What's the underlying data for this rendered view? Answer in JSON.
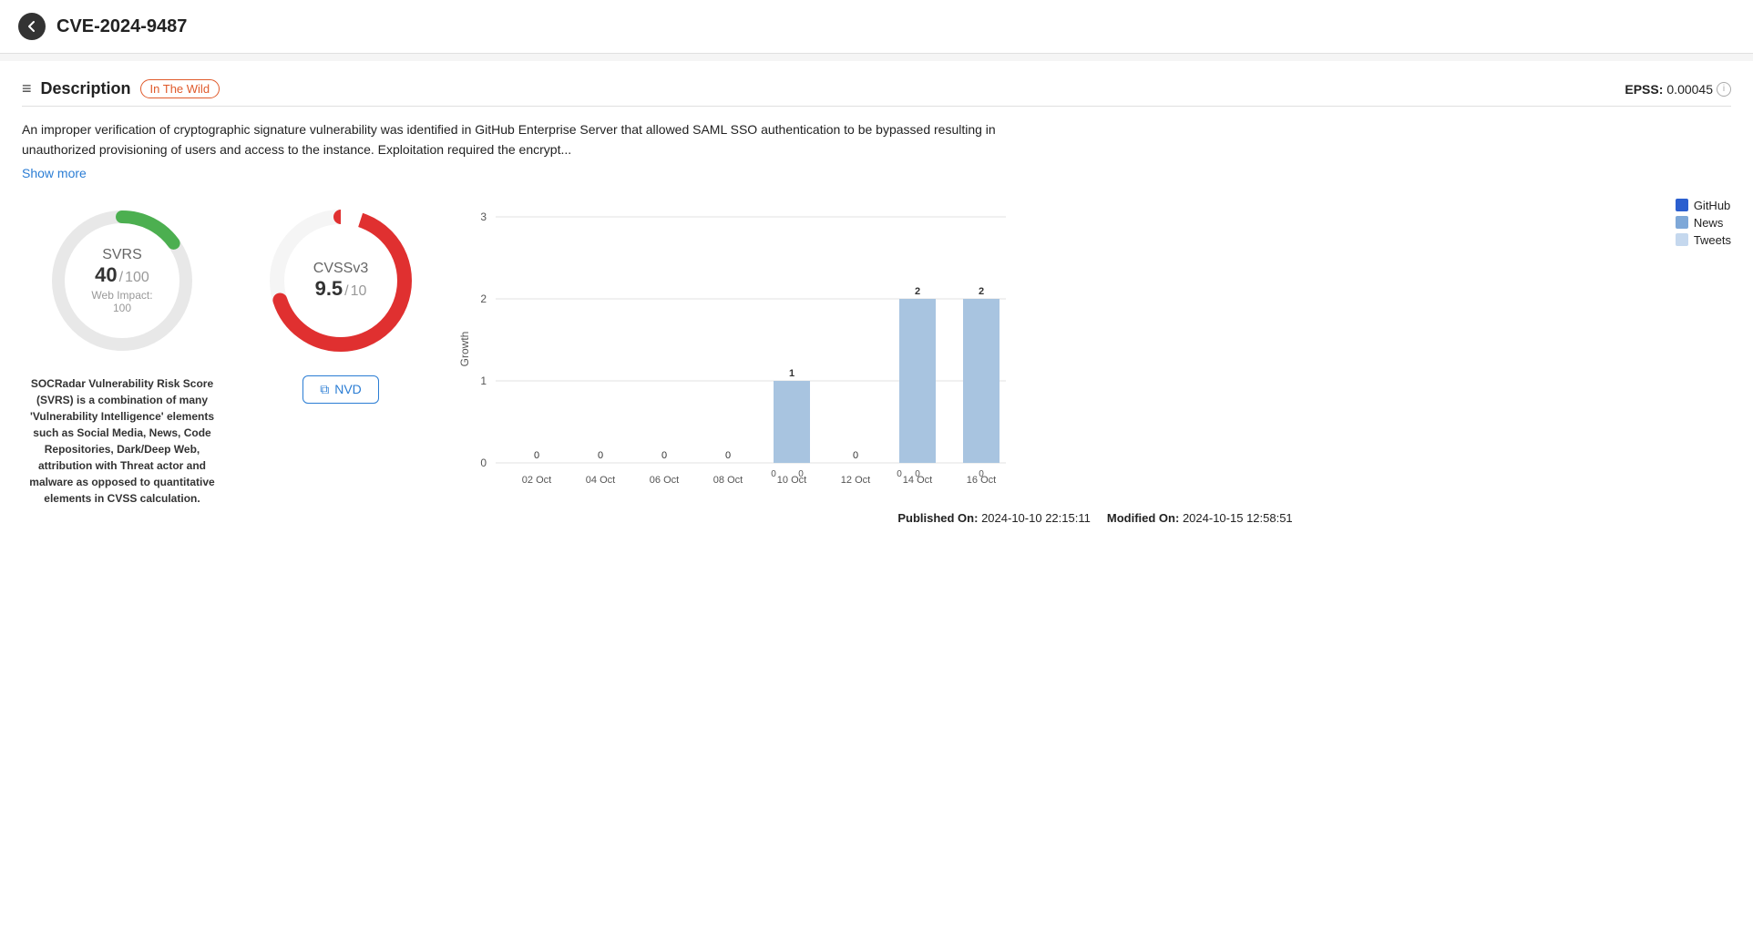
{
  "header": {
    "back_label": "←",
    "title": "CVE-2024-9487"
  },
  "description_section": {
    "icon": "≡",
    "title": "Description",
    "badge": "In The Wild",
    "epss_label": "EPSS:",
    "epss_value": "0.00045",
    "info_icon": "i",
    "text": "An improper verification of cryptographic signature vulnerability was identified in GitHub Enterprise Server that allowed SAML SSO authentication to be bypassed resulting in unauthorized provisioning of users and access to the instance. Exploitation required the encrypt...",
    "show_more": "Show more"
  },
  "svrs": {
    "label": "SVRS",
    "value": "40",
    "separator": "/",
    "max": "100",
    "impact_label": "Web Impact: 100",
    "description": "SOCRadar Vulnerability Risk Score (SVRS) is a combination of many 'Vulnerability Intelligence' elements such as Social Media, News, Code Repositories, Dark/Deep Web, attribution with Threat actor and malware as opposed to quantitative elements in CVSS calculation."
  },
  "cvss": {
    "label": "CVSSv3",
    "value": "9.5",
    "separator": "/",
    "max": "10",
    "nvd_label": "NVD",
    "nvd_icon": "⧉"
  },
  "chart": {
    "y_labels": [
      "3",
      "2",
      "1",
      "0"
    ],
    "x_labels": [
      "02 Oct",
      "04 Oct",
      "06 Oct",
      "08 Oct",
      "10 Oct",
      "12 Oct",
      "14 Oct",
      "16 Oct"
    ],
    "y_axis_label": "Growth",
    "legend": [
      {
        "color": "github",
        "label": "GitHub"
      },
      {
        "color": "news",
        "label": "News"
      },
      {
        "color": "tweets",
        "label": "Tweets"
      }
    ],
    "bars": [
      {
        "date": "02 Oct",
        "value": 0,
        "label": "0"
      },
      {
        "date": "04 Oct",
        "value": 0,
        "label": "0"
      },
      {
        "date": "06 Oct",
        "value": 0,
        "label": "0"
      },
      {
        "date": "08 Oct",
        "value": 0,
        "label": "0"
      },
      {
        "date": "10 Oct",
        "value": 1,
        "label": "1"
      },
      {
        "date": "12 Oct",
        "value": 0,
        "label": "0"
      },
      {
        "date": "14 Oct",
        "value": 2,
        "label": "2"
      },
      {
        "date": "16 Oct",
        "value": 2,
        "label": "2"
      }
    ],
    "zero_labels": [
      "0",
      "0",
      "0",
      "0",
      "0",
      "0",
      "0",
      "0"
    ]
  },
  "footer": {
    "published_label": "Published On:",
    "published_value": "2024-10-10 22:15:11",
    "modified_label": "Modified On:",
    "modified_value": "2024-10-15 12:58:51"
  }
}
